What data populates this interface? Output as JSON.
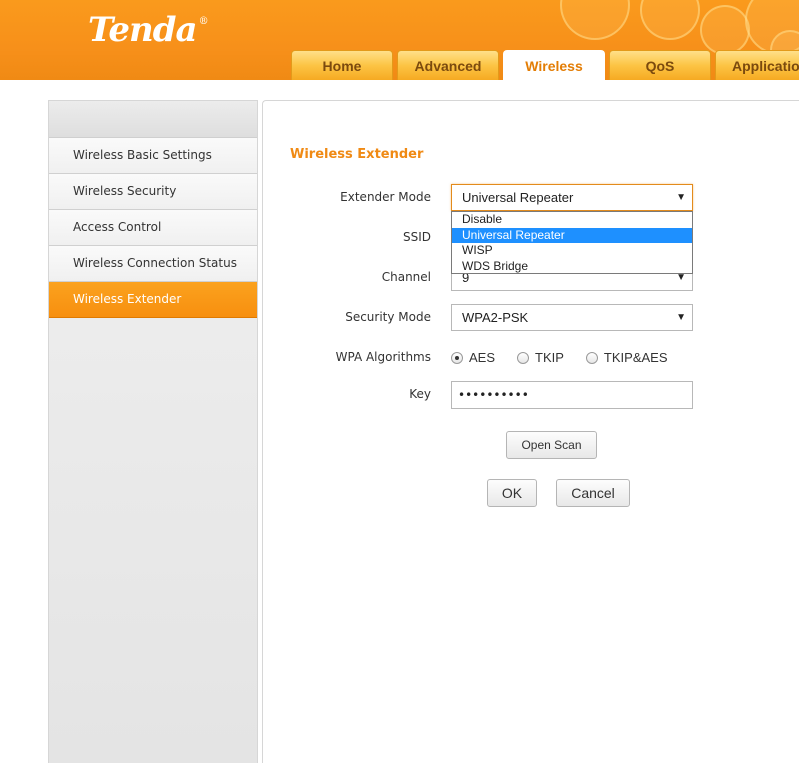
{
  "brand": {
    "logo_text": "Tenda",
    "logo_mark": "®"
  },
  "nav": {
    "tabs": [
      {
        "label": "Home",
        "active": false
      },
      {
        "label": "Advanced",
        "active": false
      },
      {
        "label": "Wireless",
        "active": true
      },
      {
        "label": "QoS",
        "active": false
      },
      {
        "label": "Application",
        "active": false
      }
    ]
  },
  "sidebar": {
    "items": [
      {
        "label": "Wireless Basic Settings",
        "active": false
      },
      {
        "label": "Wireless Security",
        "active": false
      },
      {
        "label": "Access Control",
        "active": false
      },
      {
        "label": "Wireless Connection Status",
        "active": false
      },
      {
        "label": "Wireless Extender",
        "active": true
      }
    ]
  },
  "main": {
    "title": "Wireless Extender",
    "extender_mode": {
      "label": "Extender Mode",
      "value": "Universal Repeater",
      "options": [
        "Disable",
        "Universal Repeater",
        "WISP",
        "WDS Bridge"
      ],
      "selected_index": 1
    },
    "ssid": {
      "label": "SSID"
    },
    "channel": {
      "label": "Channel",
      "value": "9"
    },
    "security_mode": {
      "label": "Security Mode",
      "value": "WPA2-PSK"
    },
    "wpa_algorithms": {
      "label": "WPA Algorithms",
      "options": [
        "AES",
        "TKIP",
        "TKIP&AES"
      ],
      "selected": "AES"
    },
    "key": {
      "label": "Key",
      "value": "••••••••••"
    },
    "buttons": {
      "open_scan": "Open Scan",
      "ok": "OK",
      "cancel": "Cancel"
    }
  },
  "icons": {
    "dropdown_arrow": "▼"
  },
  "colors": {
    "brand_orange": "#f7901a",
    "accent_text": "#f08a14",
    "selection_blue": "#1e90ff"
  }
}
